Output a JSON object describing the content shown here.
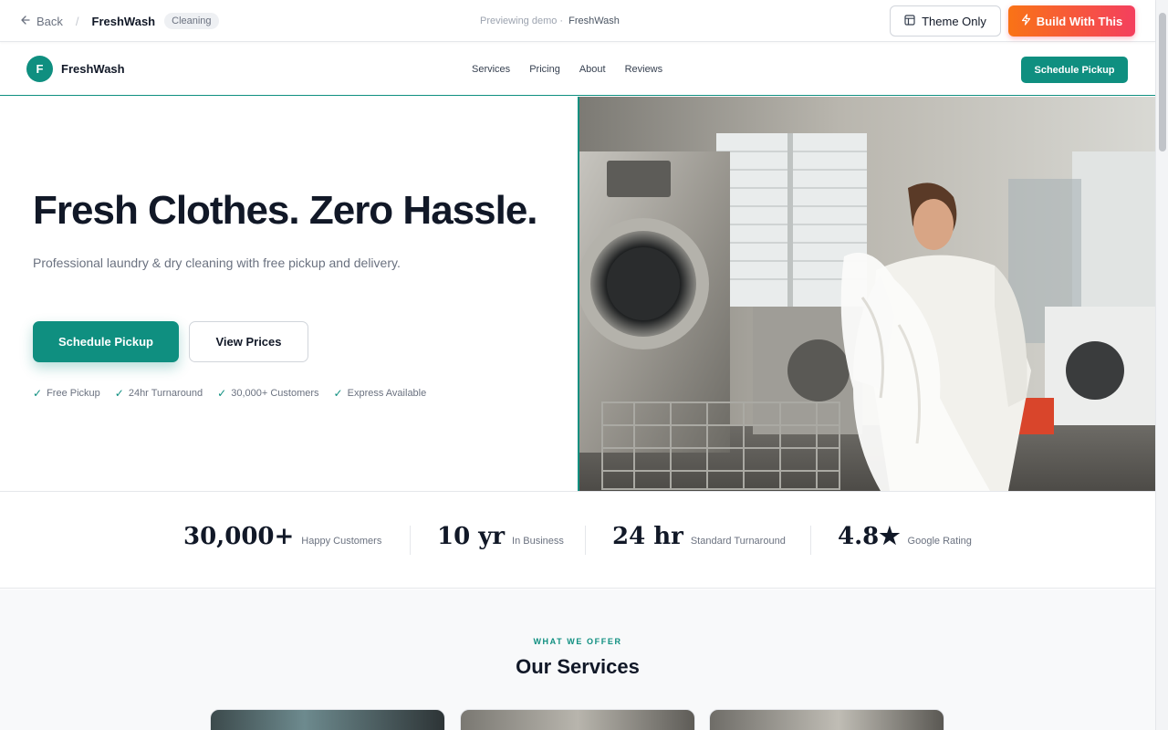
{
  "preview_bar": {
    "back_label": "Back",
    "brand": "FreshWash",
    "category": "Cleaning",
    "center_prefix": "Previewing demo ·",
    "center_brand": "FreshWash",
    "theme_only_label": "Theme Only",
    "build_label": "Build With This"
  },
  "nav": {
    "logo_letter": "F",
    "logo_text": "FreshWash",
    "links": [
      "Services",
      "Pricing",
      "About",
      "Reviews"
    ],
    "cta_label": "Schedule Pickup"
  },
  "hero": {
    "title": "Fresh Clothes. Zero Hassle.",
    "subtitle": "Professional laundry & dry cleaning with free pickup and delivery.",
    "primary_label": "Schedule Pickup",
    "secondary_label": "View Prices",
    "features": [
      "Free Pickup",
      "24hr Turnaround",
      "30,000+ Customers",
      "Express Available"
    ]
  },
  "stats": [
    {
      "value": "30,000+",
      "label": "Happy Customers"
    },
    {
      "value": "10 yr",
      "label": "In Business"
    },
    {
      "value": "24 hr",
      "label": "Standard Turnaround"
    },
    {
      "value": "4.8★",
      "label": "Google Rating"
    }
  ],
  "services": {
    "eyebrow": "WHAT WE OFFER",
    "title": "Our Services"
  },
  "colors": {
    "brand": "#0f8f80",
    "build_gradient_start": "#f97316",
    "build_gradient_end": "#f43f5e"
  }
}
